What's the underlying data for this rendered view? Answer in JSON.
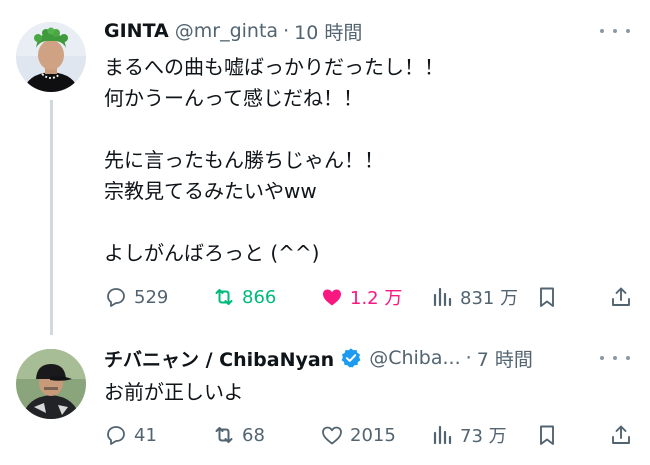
{
  "tweets": [
    {
      "author": "GINTA",
      "handle": "@mr_ginta",
      "separator": "·",
      "time": "10 時間",
      "avatar_icon": "profile-avatar-green-hair",
      "text": "まるへの曲も嘘ばっかりだったし！！\n何かうーんって感じだね！！\n\n先に言ったもん勝ちじゃん！！\n宗教見てるみたいやww\n\nよしがんばろっと (^^)",
      "replies": "529",
      "retweets": "866",
      "likes": "1.2 万",
      "views": "831 万",
      "retweeted": true,
      "liked": true
    },
    {
      "author": "チバニャン / ChibaNyan",
      "verified": true,
      "handle": "@Chiba...",
      "separator": "·",
      "time": "7 時間",
      "avatar_icon": "profile-avatar-cap",
      "text": "お前が正しいよ",
      "replies": "41",
      "retweets": "68",
      "likes": "2015",
      "views": "73 万",
      "retweeted": false,
      "liked": false
    }
  ],
  "colors": {
    "text": "#0f1419",
    "secondary": "#536471",
    "retweet_green": "#00ba7c",
    "like_pink": "#f91880",
    "verified_blue": "#1d9bf0",
    "thread_line": "#cfd9de"
  }
}
